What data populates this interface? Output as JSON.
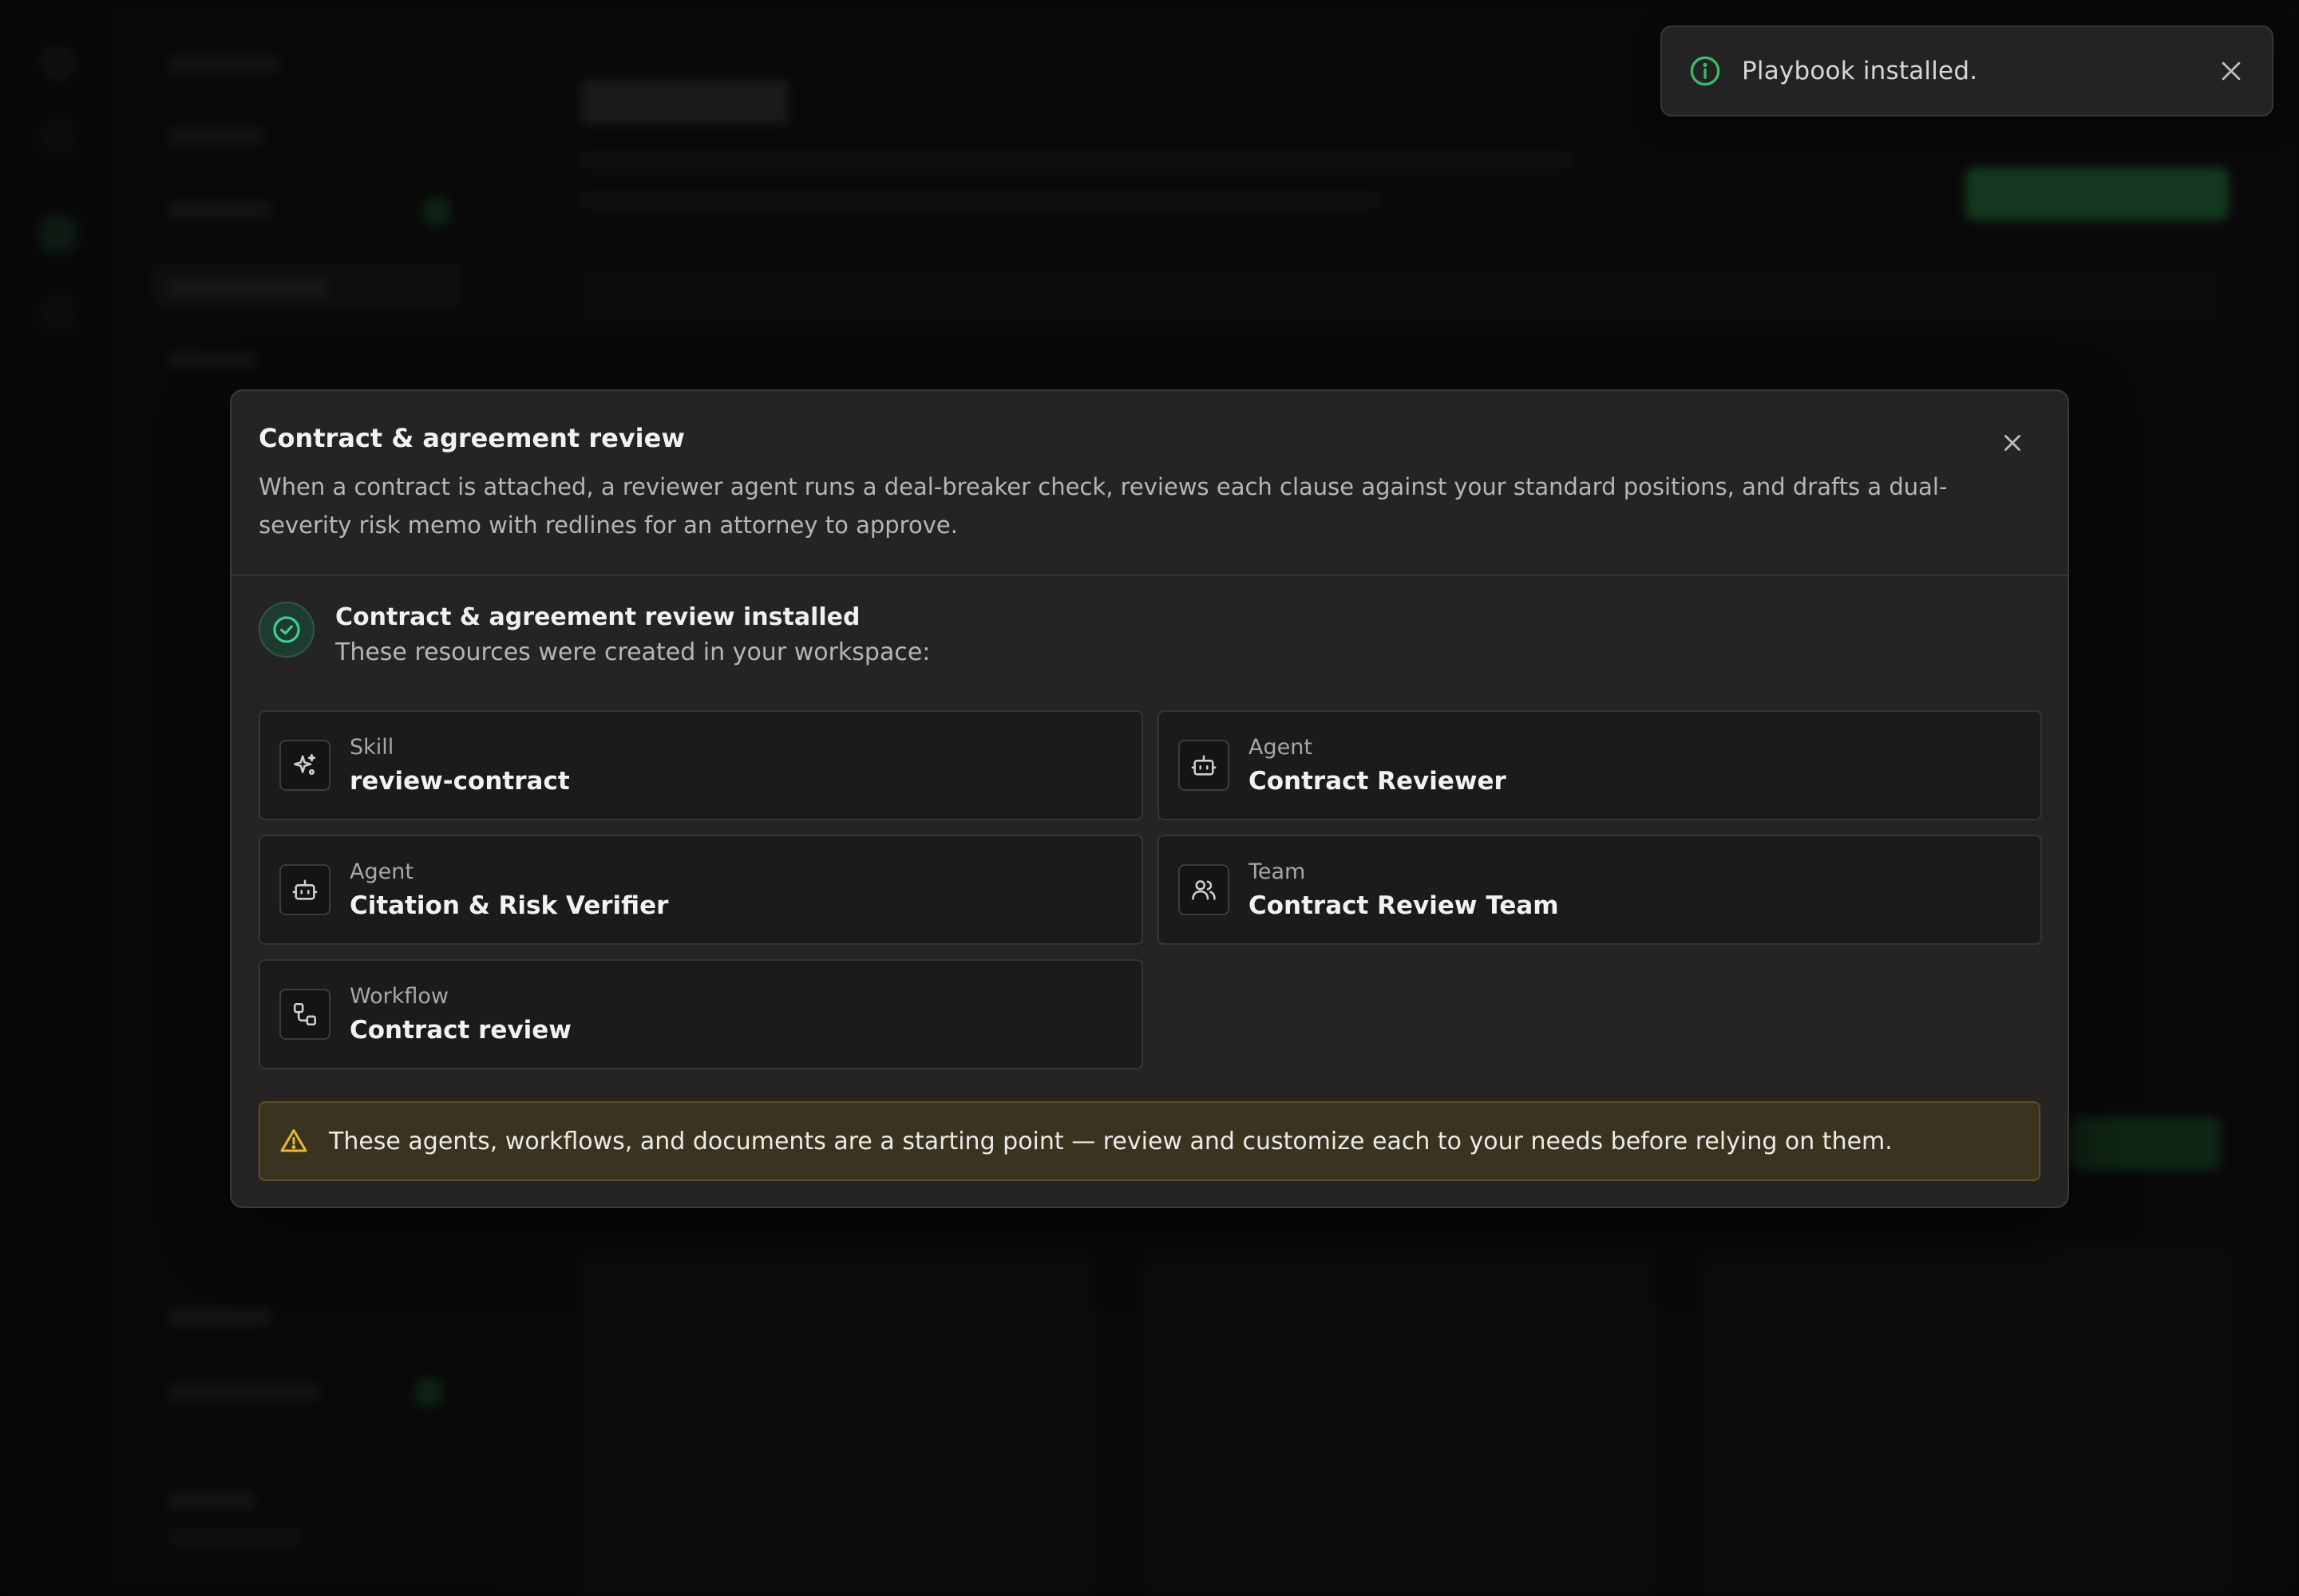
{
  "toast": {
    "message": "Playbook installed.",
    "icon": "info-icon",
    "accent": "#3fb968"
  },
  "modal": {
    "title": "Contract & agreement review",
    "description": "When a contract is attached, a reviewer agent runs a deal-breaker check, reviews each clause against your standard positions, and drafts a dual-severity risk memo with redlines for an attorney to approve.",
    "success": {
      "title": "Contract & agreement review installed",
      "subtitle": "These resources were created in your workspace:"
    },
    "resources": [
      {
        "kind": "Skill",
        "name": "review-contract",
        "icon": "sparkle-icon"
      },
      {
        "kind": "Agent",
        "name": "Contract Reviewer",
        "icon": "robot-icon"
      },
      {
        "kind": "Agent",
        "name": "Citation & Risk Verifier",
        "icon": "robot-icon"
      },
      {
        "kind": "Team",
        "name": "Contract Review Team",
        "icon": "users-icon"
      },
      {
        "kind": "Workflow",
        "name": "Contract review",
        "icon": "workflow-icon"
      }
    ],
    "warning": "These agents, workflows, and documents are a starting point — review and customize each to your needs before relying on them."
  },
  "colors": {
    "success_green": "#3fcf8e",
    "warning_amber": "#e8b931",
    "modal_bg": "#252423"
  }
}
